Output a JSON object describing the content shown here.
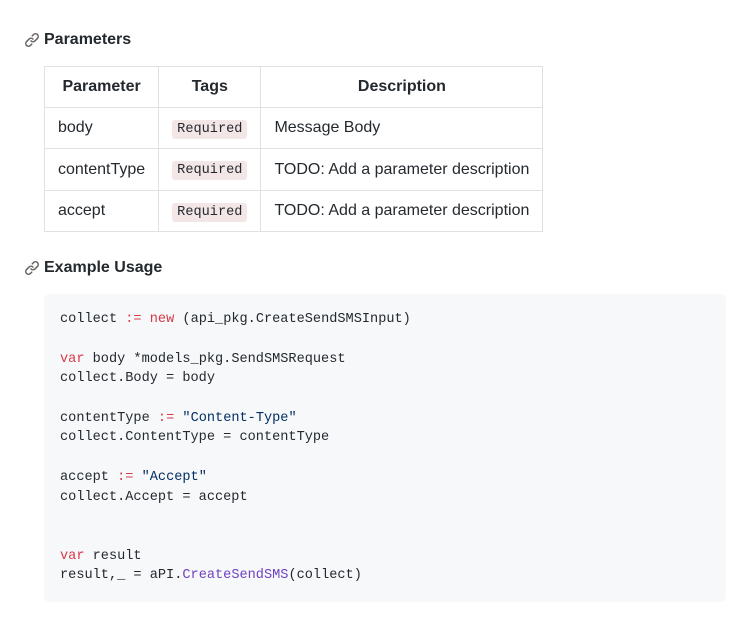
{
  "headings": {
    "parameters": "Parameters",
    "example_usage": "Example Usage"
  },
  "icons": {
    "link": "link-icon"
  },
  "table": {
    "headers": {
      "param": "Parameter",
      "tags": "Tags",
      "desc": "Description"
    },
    "rows": [
      {
        "param": "body",
        "tag": "Required",
        "desc": "Message Body"
      },
      {
        "param": "contentType",
        "tag": "Required",
        "desc": "TODO: Add a parameter description"
      },
      {
        "param": "accept",
        "tag": "Required",
        "desc": "TODO: Add a parameter description"
      }
    ]
  },
  "code": {
    "t1a": "collect ",
    "op1": ":=",
    "t1b": " ",
    "kw1": "new",
    "t1c": " (api_pkg.CreateSendSMSInput)",
    "kw2": "var",
    "t2": " body *models_pkg.SendSMSRequest",
    "t3": "collect.Body = body",
    "t4a": "contentType ",
    "op2": ":=",
    "t4b": " ",
    "str1": "\"Content-Type\"",
    "t5": "collect.ContentType = contentType",
    "t6a": "accept ",
    "op3": ":=",
    "t6b": " ",
    "str2": "\"Accept\"",
    "t7": "collect.Accept = accept",
    "kw3": "var",
    "t8": " result",
    "t9a": "result,_ = aPI.",
    "fn1": "CreateSendSMS",
    "t9b": "(collect)"
  }
}
